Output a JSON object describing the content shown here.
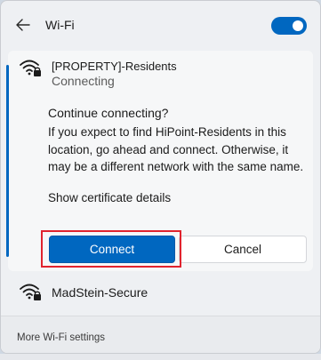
{
  "header": {
    "back_icon": "back-arrow-icon",
    "title": "Wi-Fi",
    "toggle_on": true,
    "toggle_color": "#0067c0"
  },
  "selected_network": {
    "name": "[PROPERTY]-Residents",
    "status": "Connecting",
    "icon": "wifi-secured-icon",
    "prompt_title": "Continue connecting?",
    "prompt_body": "If you expect to find HiPoint-Residents in this location, go ahead and connect. Otherwise, it may be a different network with the same name.",
    "certificate_link": "Show certificate details",
    "connect_label": "Connect",
    "cancel_label": "Cancel",
    "accent_color": "#0067c0"
  },
  "other_networks": [
    {
      "name": "MadStein-Secure",
      "icon": "wifi-secured-icon"
    }
  ],
  "footer": {
    "more_settings_label": "More Wi-Fi settings"
  },
  "highlight_color": "#e0232e"
}
